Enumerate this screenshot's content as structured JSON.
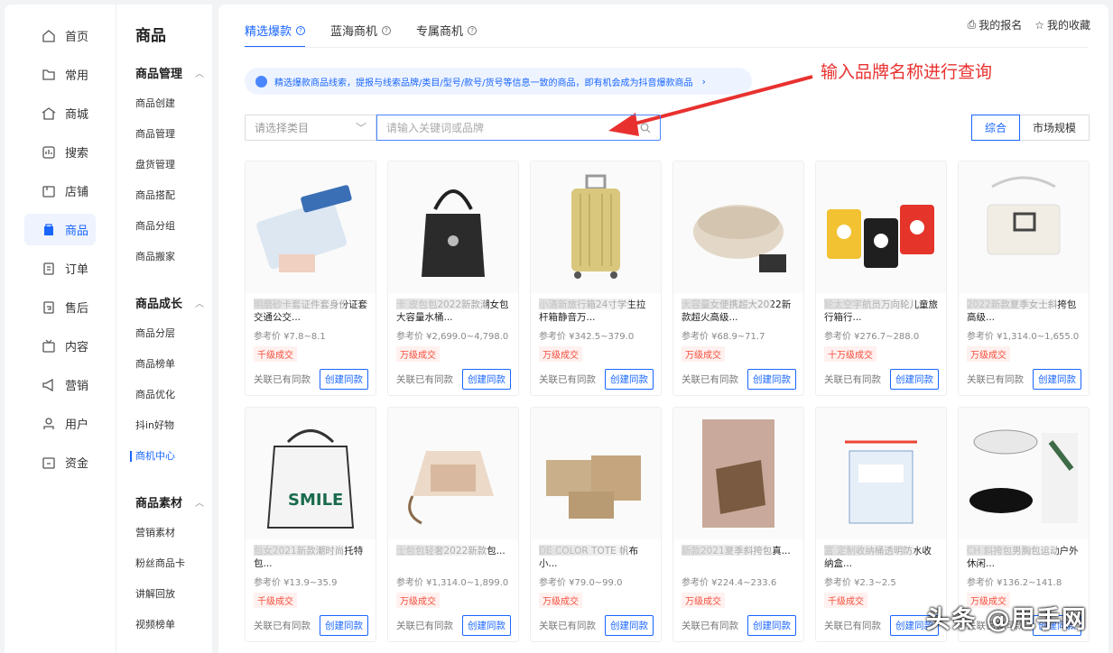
{
  "nav": [
    {
      "label": "首页",
      "icon": "home-icon"
    },
    {
      "label": "常用",
      "icon": "folder-icon"
    },
    {
      "label": "商城",
      "icon": "shop-icon"
    },
    {
      "label": "搜索",
      "icon": "search-icon"
    },
    {
      "label": "店铺",
      "icon": "store-icon"
    },
    {
      "label": "商品",
      "icon": "bag-icon"
    },
    {
      "label": "订单",
      "icon": "order-icon"
    },
    {
      "label": "售后",
      "icon": "aftersale-icon"
    },
    {
      "label": "内容",
      "icon": "tv-icon"
    },
    {
      "label": "营销",
      "icon": "megaphone-icon"
    },
    {
      "label": "用户",
      "icon": "user-icon"
    },
    {
      "label": "资金",
      "icon": "wallet-icon"
    }
  ],
  "sub": {
    "title": "商品",
    "group1": "商品管理",
    "group1_items": [
      "商品创建",
      "商品管理",
      "盘货管理",
      "商品搭配",
      "商品分组",
      "商品搬家"
    ],
    "group2": "商品成长",
    "group2_items": [
      "商品分层",
      "商品榜单",
      "商品优化",
      "抖in好物",
      "商机中心"
    ],
    "group3": "商品素材",
    "group3_items": [
      "营销素材",
      "粉丝商品卡",
      "讲解回放",
      "视频榜单"
    ]
  },
  "tabs": [
    "精选爆款",
    "蓝海商机",
    "专属商机"
  ],
  "top_links": {
    "report": "我的报名",
    "favorite": "我的收藏"
  },
  "notice": "精选爆款商品线索，提报与线索品牌/类目/型号/款号/货号等信息一致的商品，即有机会成为抖音爆款商品",
  "annotation": "输入品牌名称进行查询",
  "filters": {
    "category_placeholder": "请选择类目",
    "search_placeholder": "请输入关键词或品牌"
  },
  "sort": {
    "a": "综合",
    "b": "市场规模"
  },
  "labels": {
    "related": "关联已有同款",
    "create": "创建同款"
  },
  "products": [
    {
      "title": "明磨砂卡套证件套身份证套交通公交...",
      "price": "参考价 ¥7.8~8.1",
      "badge": "千级成交"
    },
    {
      "title": "卡 皮包包2022新款潮女包大容量水桶...",
      "price": "参考价 ¥2,699.0~4,798.0",
      "badge": "万级成交"
    },
    {
      "title": "小清新旅行箱24寸学生拉杆箱静音万...",
      "price": "参考价 ¥342.5~379.0",
      "badge": "万级成交"
    },
    {
      "title": "大容量女便携超大2022新款超火高级...",
      "price": "参考价 ¥68.9~71.7",
      "badge": "万级成交"
    },
    {
      "title": "轮太空宇航员万向轮儿童旅行箱行...",
      "price": "参考价 ¥276.7~288.0",
      "badge": "十万级成交"
    },
    {
      "title": "2022新款夏季女士斜挎包高级...",
      "price": "参考价 ¥1,314.0~1,655.0",
      "badge": "万级成交"
    },
    {
      "title": "包女2021新款潮时尚托特包...",
      "price": "参考价 ¥13.9~35.9",
      "badge": "千级成交"
    },
    {
      "title": "士包包轻奢2022新款包...",
      "price": "参考价 ¥1,314.0~1,899.0",
      "badge": "万级成交"
    },
    {
      "title": "DE COLOR TOTE 帆布小...",
      "price": "参考价 ¥79.0~99.0",
      "badge": "万级成交"
    },
    {
      "title": "新款2021夏季斜挎包真...",
      "price": "参考价 ¥224.4~233.6",
      "badge": "万级成交"
    },
    {
      "title": "富 定制收纳桶透明防水收纳盒...",
      "price": "参考价 ¥2.3~2.5",
      "badge": "千级成交"
    },
    {
      "title": "CH 斜挎包男胸包运动户外休闲...",
      "price": "参考价 ¥136.2~141.8",
      "badge": "万级成交"
    }
  ],
  "watermark": "头条 @甩手网",
  "colors": {
    "accent": "#1966ff",
    "badge": "#f5503e",
    "annotation": "#e8312f"
  }
}
